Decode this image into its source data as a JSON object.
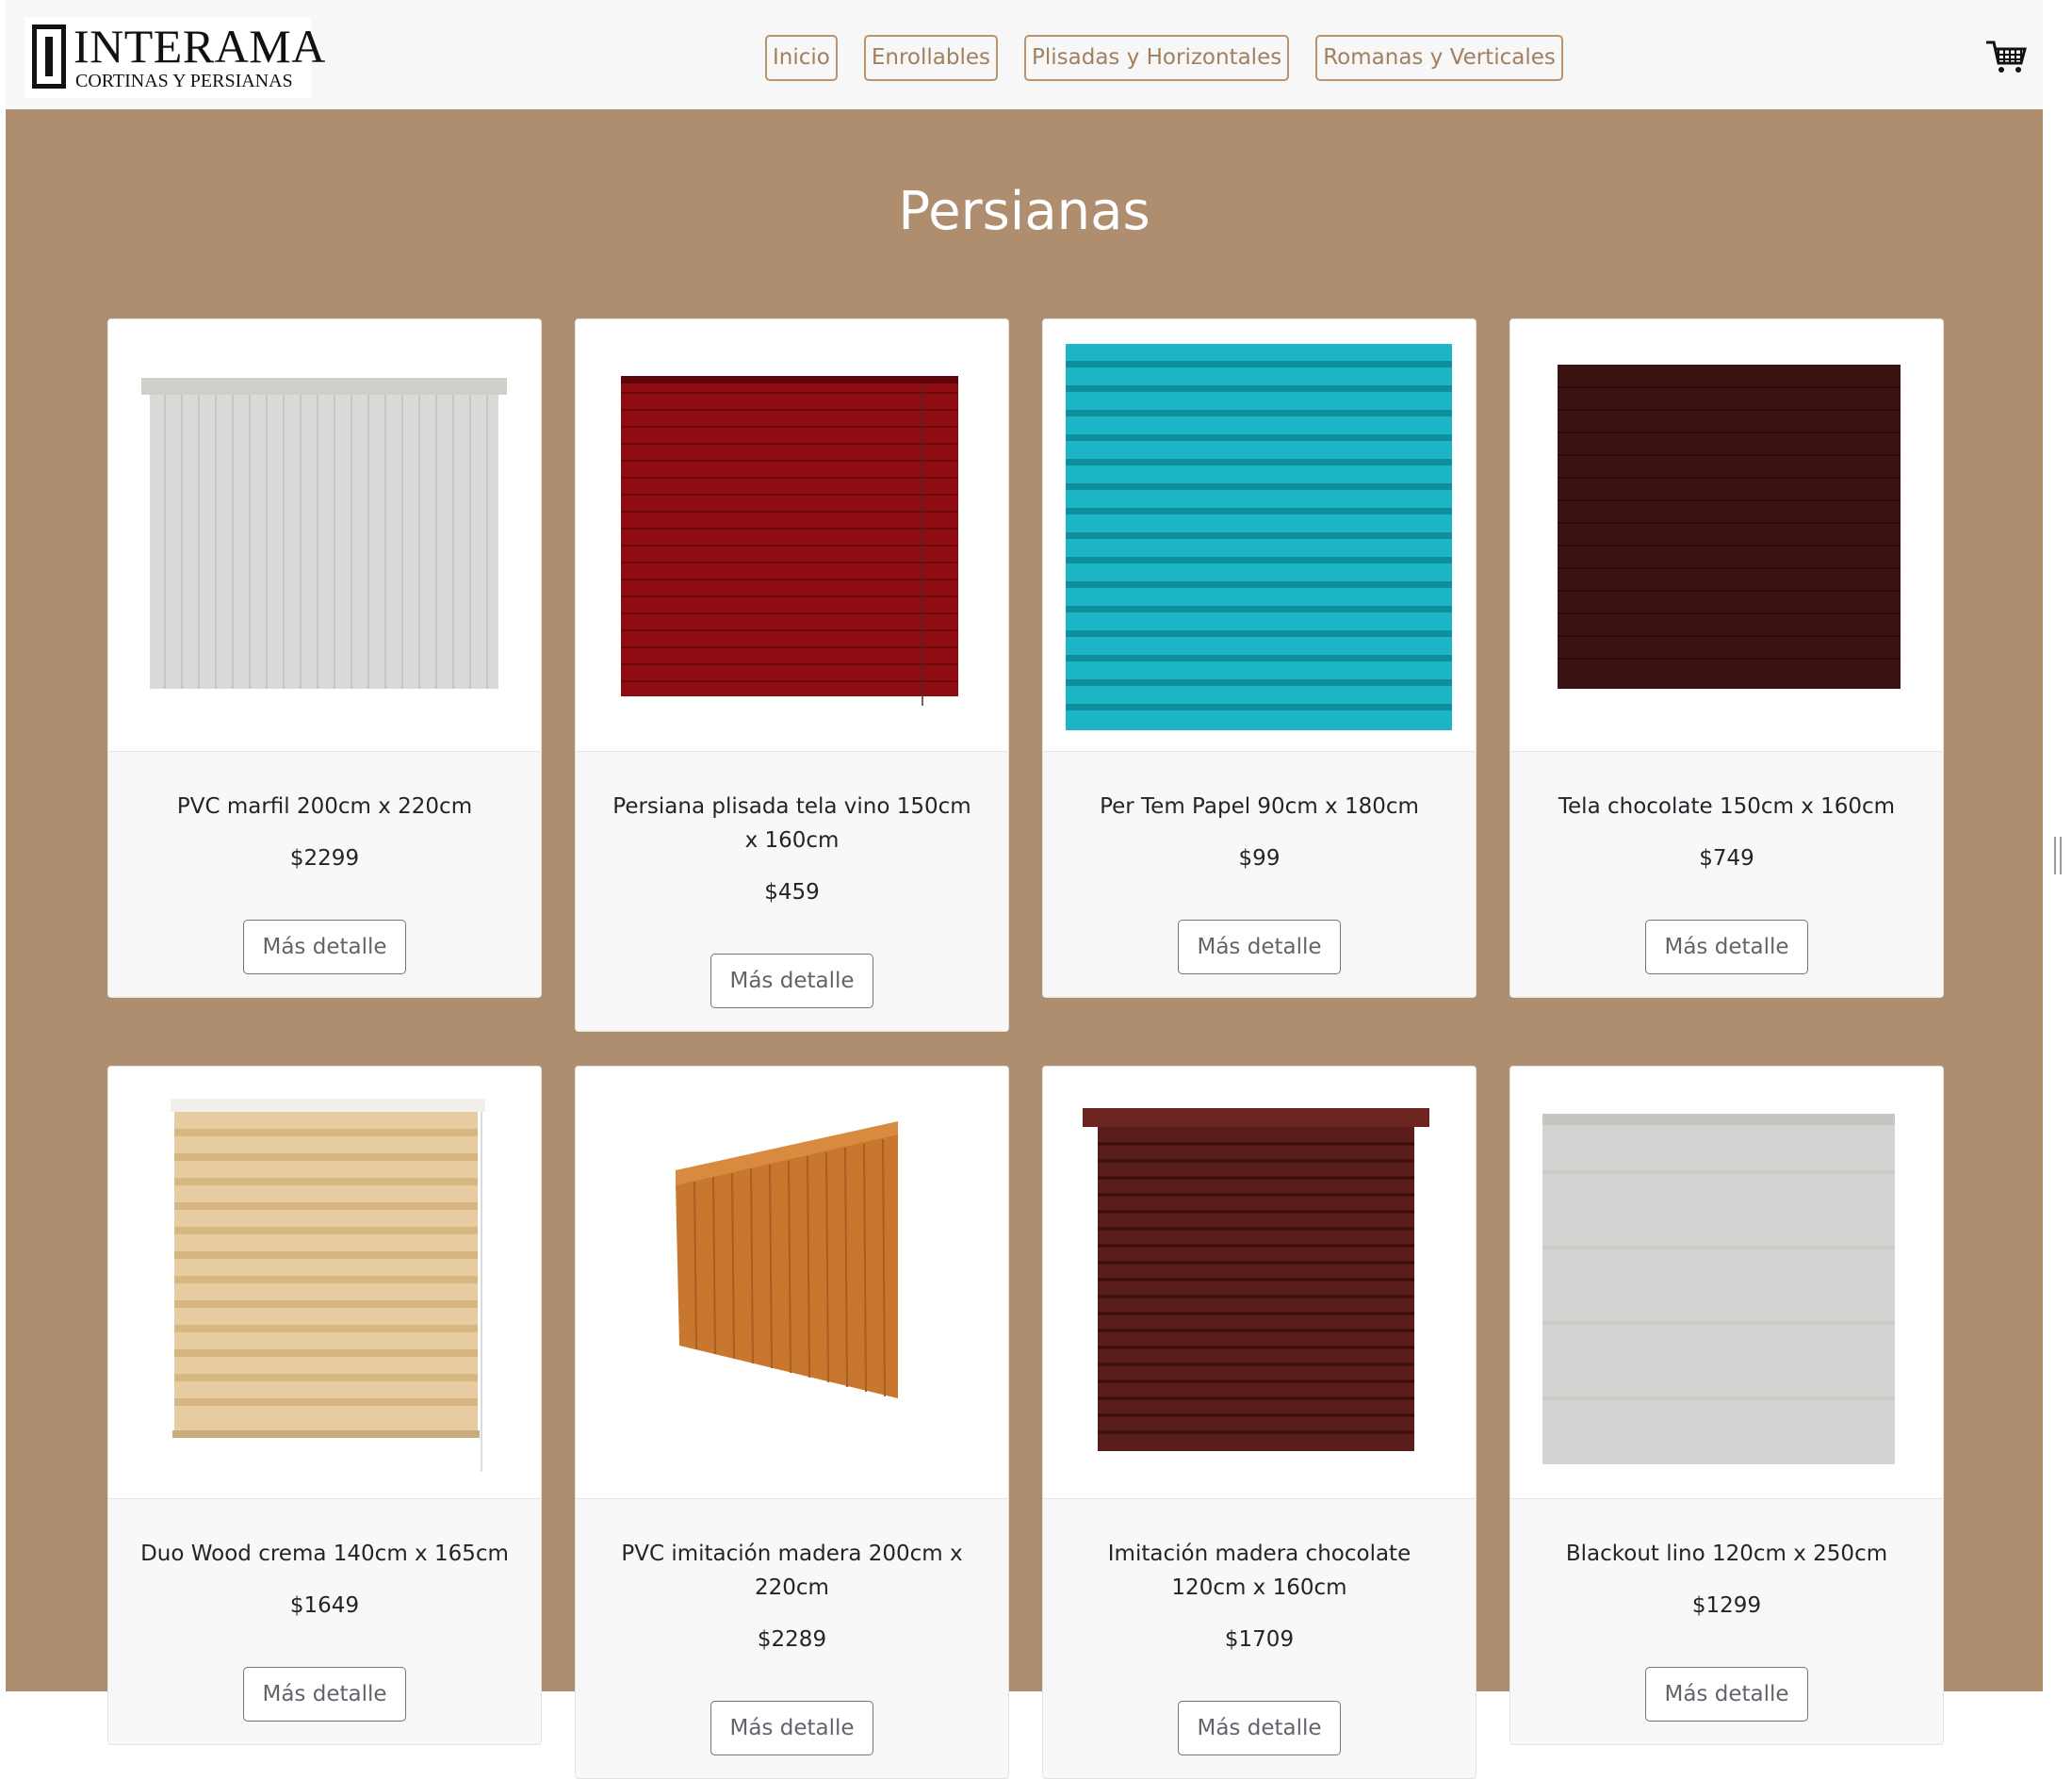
{
  "brand": {
    "name": "INTERAMA",
    "tagline": "CORTINAS Y PERSIANAS"
  },
  "nav": [
    "Inicio",
    "Enrollables",
    "Plisadas y Horizontales",
    "Romanas y Verticales"
  ],
  "cart_icon": "shopping-cart-icon",
  "page_title": "Persianas",
  "button_label": "Más detalle",
  "products": [
    {
      "name": "PVC marfil 200cm x 220cm",
      "price": "$2299",
      "color": "#d8d9d6"
    },
    {
      "name": "Persiana plisada tela vino 150cm x 160cm",
      "price": "$459",
      "color": "#8c0d12"
    },
    {
      "name": "Per Tem Papel 90cm x 180cm",
      "price": "$99",
      "color": "#1bb7c8"
    },
    {
      "name": "Tela chocolate 150cm x 160cm",
      "price": "$749",
      "color": "#3b1414"
    },
    {
      "name": "Duo Wood crema 140cm x 165cm",
      "price": "$1649",
      "color": "#e6cb9f"
    },
    {
      "name": "PVC imitación madera 200cm x 220cm",
      "price": "$2289",
      "color": "#c97b36"
    },
    {
      "name": "Imitación madera chocolate 120cm x 160cm",
      "price": "$1709",
      "color": "#5a1d1a"
    },
    {
      "name": "Blackout lino 120cm x 250cm",
      "price": "$1299",
      "color": "#d3d3d1"
    }
  ]
}
